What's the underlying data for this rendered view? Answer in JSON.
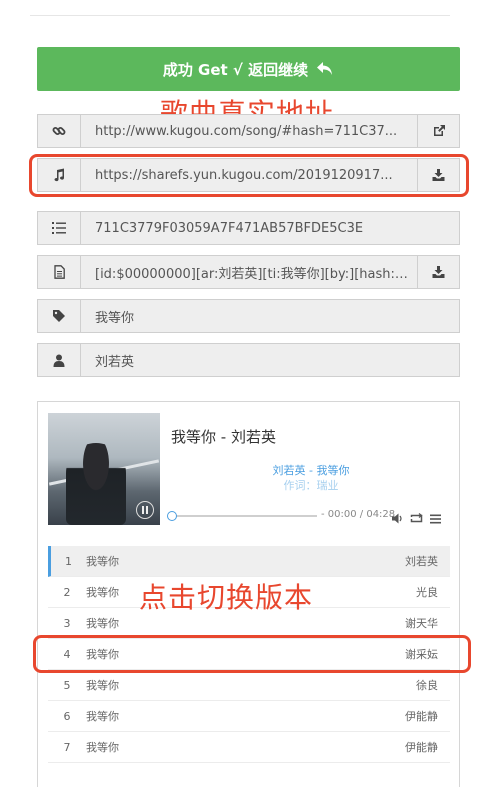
{
  "success_button": {
    "label": "成功 Get √ 返回继续"
  },
  "annotations": {
    "real_url": "歌曲真实地址",
    "switch_version": "点击切换版本"
  },
  "fields": {
    "page_url": "http://www.kugou.com/song/#hash=711C37...",
    "audio_url": "https://sharefs.yun.kugou.com/2019120917...",
    "hash": "711C3779F03059A7F471AB57BFDE5C3E",
    "lrc": "[id:$00000000][ar:刘若英][ti:我等你][by:][hash:f...",
    "song_name": "我等你",
    "singer": "刘若英"
  },
  "icons": {
    "link": "link-icon",
    "external": "external-link-icon",
    "music": "music-note-icon",
    "download": "download-icon",
    "list": "list-icon",
    "file": "file-icon",
    "tag": "tag-icon",
    "user": "user-icon",
    "back": "reply-icon"
  },
  "player": {
    "title": "我等你 - 刘若英",
    "lyric_line1": "刘若英 - 我等你",
    "lyric_line2": "作词：瑞业",
    "time": "- 00:00 / 04:28",
    "progress": 0
  },
  "playlist": [
    {
      "num": "1",
      "name": "我等你",
      "artist": "刘若英"
    },
    {
      "num": "2",
      "name": "我等你",
      "artist": "光良"
    },
    {
      "num": "3",
      "name": "我等你",
      "artist": "谢天华"
    },
    {
      "num": "4",
      "name": "我等你",
      "artist": "谢采妘"
    },
    {
      "num": "5",
      "name": "我等你",
      "artist": "徐良"
    },
    {
      "num": "6",
      "name": "我等你",
      "artist": "伊能静"
    },
    {
      "num": "7",
      "name": "我等你",
      "artist": "伊能静"
    }
  ],
  "colors": {
    "success": "#5cb85c",
    "annotation": "#e8472e",
    "accent": "#4a9ee0"
  }
}
